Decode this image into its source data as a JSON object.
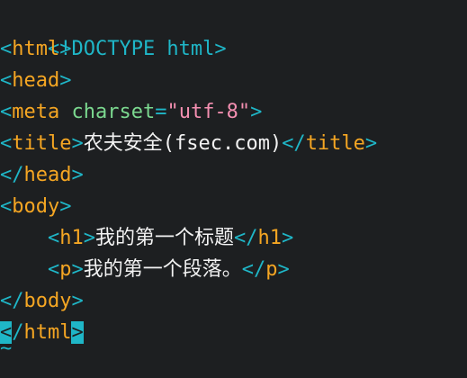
{
  "doctype": "<!DOCTYPE html>",
  "html_open_name": "html",
  "head_open_name": "head",
  "meta_tag_name": "meta",
  "meta_attr_name": "charset",
  "meta_attr_value": "\"utf-8\"",
  "title_tag_name": "title",
  "title_text": "农夫安全(fsec.com)",
  "head_close_name": "head",
  "body_open_name": "body",
  "h1_tag_name": "h1",
  "h1_text": "我的第一个标题",
  "p_tag_name": "p",
  "p_text": "我的第一个段落。",
  "body_close_name": "body",
  "html_close_name": "html",
  "tilde": "~",
  "indent": "    "
}
